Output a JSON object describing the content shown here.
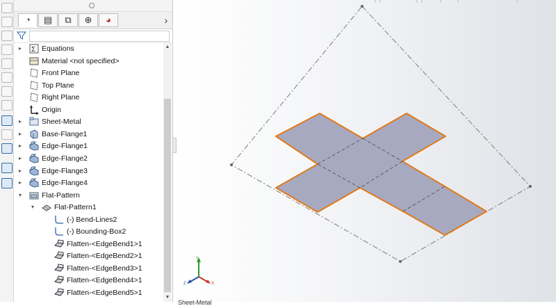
{
  "tabs": [
    {
      "name": "feature-manager-tab",
      "glyph": "◔"
    },
    {
      "name": "property-manager-tab",
      "glyph": "▤"
    },
    {
      "name": "configuration-manager-tab",
      "glyph": "⧉"
    },
    {
      "name": "dimxpert-manager-tab",
      "glyph": "⊕"
    },
    {
      "name": "display-manager-tab",
      "glyph": "◕"
    }
  ],
  "tab_more": "›",
  "tree": [
    {
      "label": "Equations",
      "indent": 0,
      "arrow": "▸",
      "icon": "equations-icon"
    },
    {
      "label": "Material <not specified>",
      "indent": 0,
      "arrow": "",
      "icon": "material-icon"
    },
    {
      "label": "Front Plane",
      "indent": 0,
      "arrow": "",
      "icon": "plane-icon"
    },
    {
      "label": "Top Plane",
      "indent": 0,
      "arrow": "",
      "icon": "plane-icon"
    },
    {
      "label": "Right Plane",
      "indent": 0,
      "arrow": "",
      "icon": "plane-icon"
    },
    {
      "label": "Origin",
      "indent": 0,
      "arrow": "",
      "icon": "origin-icon"
    },
    {
      "label": "Sheet-Metal",
      "indent": 0,
      "arrow": "▸",
      "icon": "sheet-metal-folder-icon"
    },
    {
      "label": "Base-Flange1",
      "indent": 0,
      "arrow": "▸",
      "icon": "base-flange-icon"
    },
    {
      "label": "Edge-Flange1",
      "indent": 0,
      "arrow": "▸",
      "icon": "edge-flange-icon"
    },
    {
      "label": "Edge-Flange2",
      "indent": 0,
      "arrow": "▸",
      "icon": "edge-flange-icon"
    },
    {
      "label": "Edge-Flange3",
      "indent": 0,
      "arrow": "▸",
      "icon": "edge-flange-icon"
    },
    {
      "label": "Edge-Flange4",
      "indent": 0,
      "arrow": "▸",
      "icon": "edge-flange-icon"
    },
    {
      "label": "Flat-Pattern",
      "indent": 0,
      "arrow": "▾",
      "icon": "flat-pattern-folder-icon"
    },
    {
      "label": "Flat-Pattern1",
      "indent": 1,
      "arrow": "▾",
      "icon": "flat-pattern-icon"
    },
    {
      "label": "(-) Bend-Lines2",
      "indent": 2,
      "arrow": "",
      "icon": "sketch-icon"
    },
    {
      "label": "(-) Bounding-Box2",
      "indent": 2,
      "arrow": "",
      "icon": "sketch-icon"
    },
    {
      "label": "Flatten-<EdgeBend1>1",
      "indent": 2,
      "arrow": "",
      "icon": "flatten-icon"
    },
    {
      "label": "Flatten-<EdgeBend2>1",
      "indent": 2,
      "arrow": "",
      "icon": "flatten-icon"
    },
    {
      "label": "Flatten-<EdgeBend3>1",
      "indent": 2,
      "arrow": "",
      "icon": "flatten-icon"
    },
    {
      "label": "Flatten-<EdgeBend4>1",
      "indent": 2,
      "arrow": "",
      "icon": "flatten-icon"
    },
    {
      "label": "Flatten-<EdgeBend5>1",
      "indent": 2,
      "arrow": "",
      "icon": "flatten-icon"
    }
  ],
  "status_text": "Sheet-Metal",
  "colors": {
    "face": "#a7a9c0",
    "edge": "#e07a1a",
    "dash": "#7a7a7a",
    "accent": "#2f6aa6"
  }
}
